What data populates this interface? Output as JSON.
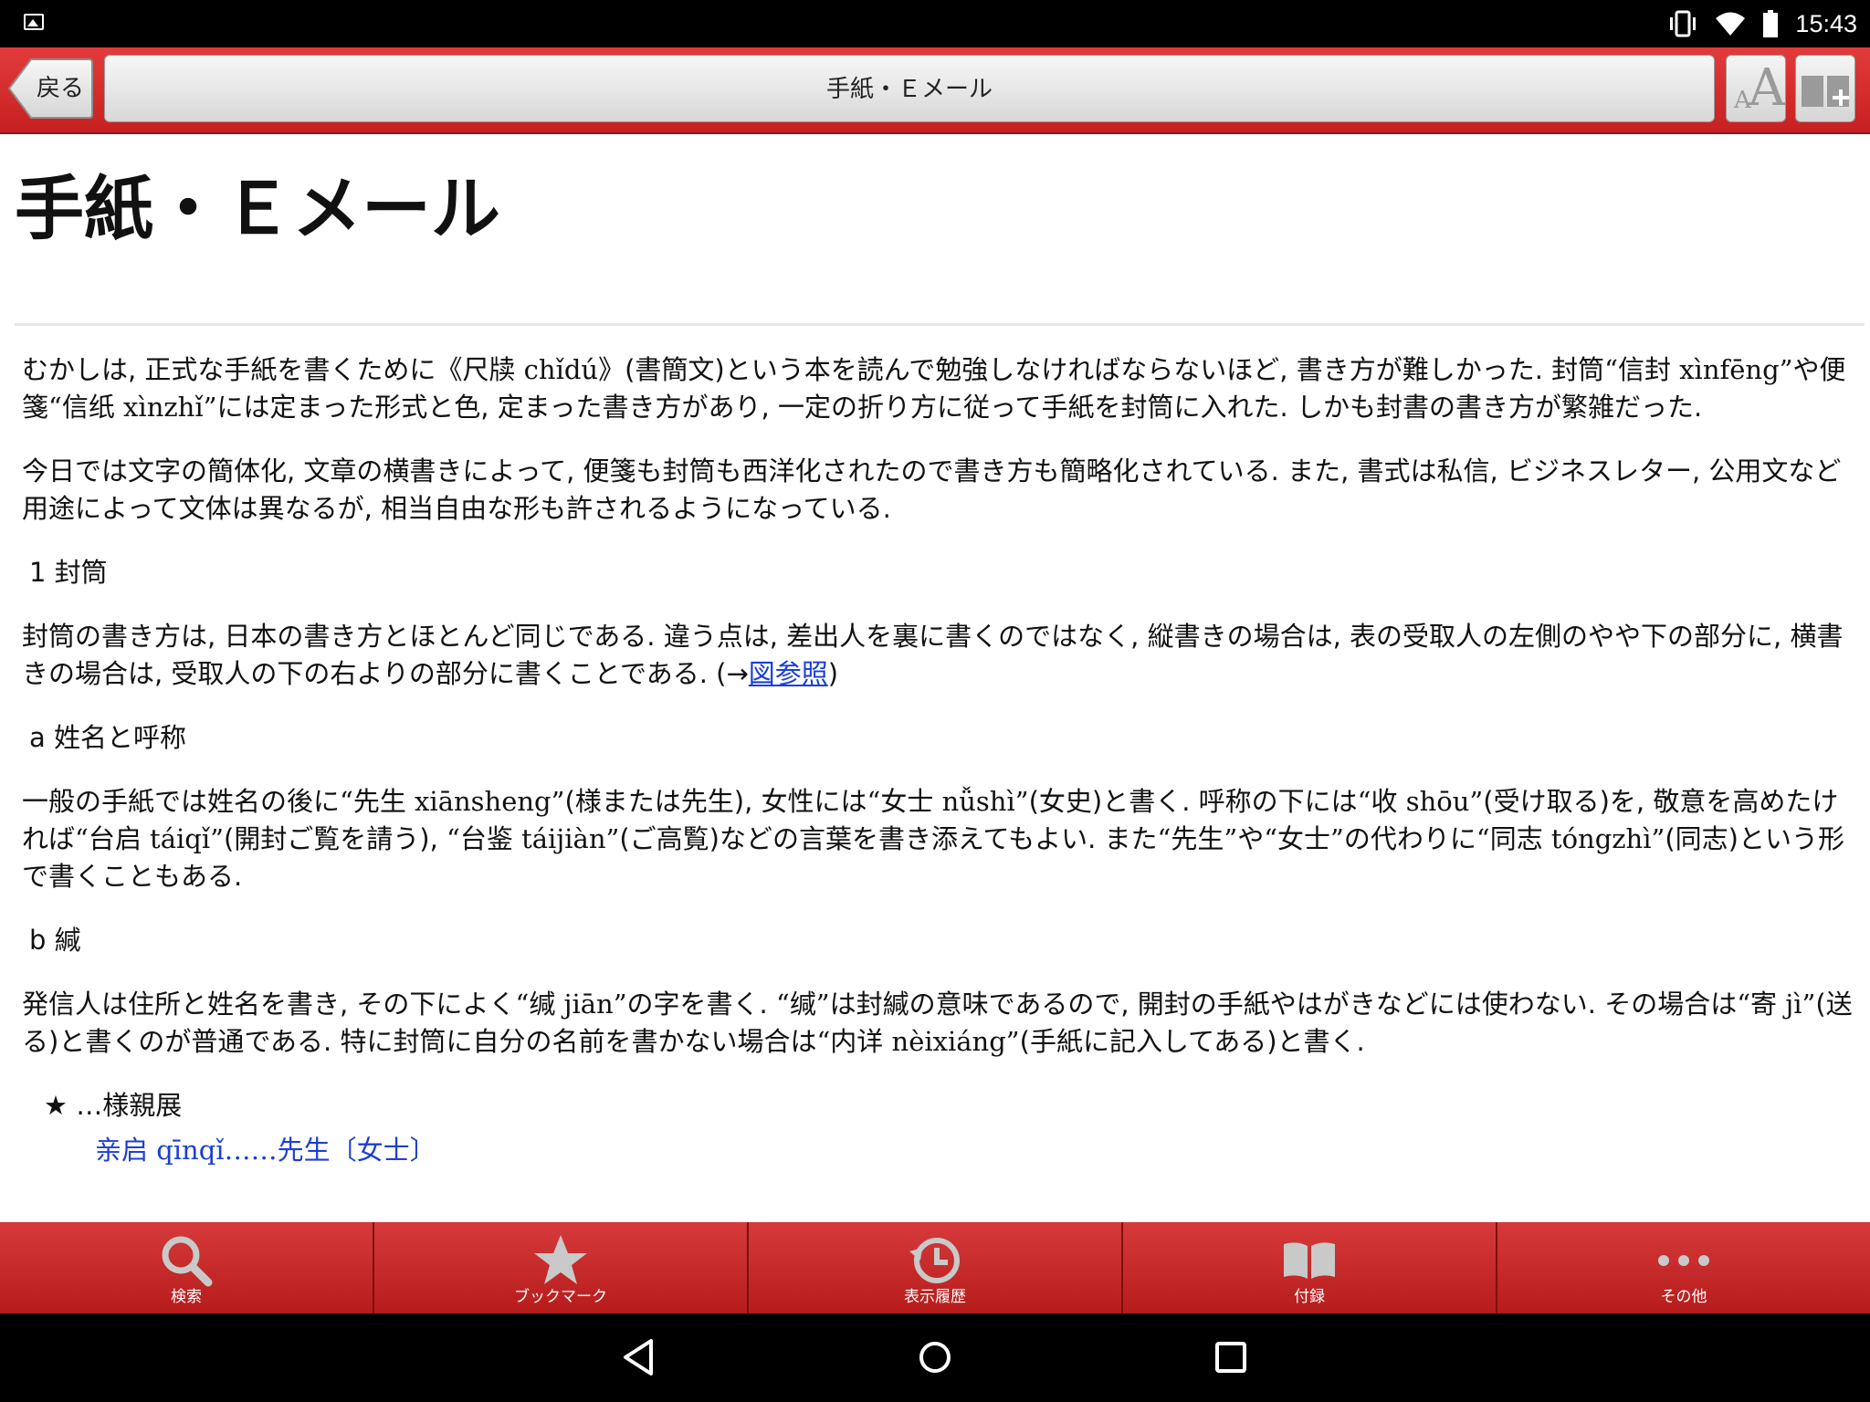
{
  "status_bar": {
    "time": "15:43"
  },
  "toolbar": {
    "back_label": "戻る",
    "title": "手紙・Ｅメール",
    "font_icon_small": "A",
    "font_icon_big": "A"
  },
  "content": {
    "title": "手紙・Ｅメール",
    "p1": [
      "むかしは, 正式な手紙を書くために",
      "《尺牍 chǐdú》",
      "(書簡文)という本を読んで勉強しなければならないほど, 書き方が難しかった. 封筒",
      "“信封 xìnfēng”",
      "や便箋",
      "“信纸 xìnzhǐ”",
      "には定まった形式と色, 定まった書き方があり, 一定の折り方に従って手紙を封筒に入れた. しかも封書の書き方が繁雑だった."
    ],
    "p2": "今日では文字の簡体化, 文章の横書きによって, 便箋も封筒も西洋化されたので書き方も簡略化されている. また, 書式は私信, ビジネスレター, 公用文など用途によって文体は異なるが, 相当自由な形も許されるようになっている.",
    "h1": "1 封筒",
    "p3_before": "封筒の書き方は, 日本の書き方とほとんど同じである. 違う点は, 差出人を裏に書くのではなく, 縦書きの場合は, 表の受取人の左側のやや下の部分に, 横書きの場合は, 受取人の下の右よりの部分に書くことである. (→",
    "p3_link": "図参照",
    "p3_after": ")",
    "h2": "a 姓名と呼称",
    "p4": [
      "一般の手紙では姓名の後に",
      "“先生 xiānsheng”",
      "(様または先生), 女性には",
      "“女士 nǚshì”",
      "(女史)と書く. 呼称の下には",
      "“收 shōu”",
      "(受け取る)を, 敬意を高めたければ",
      "“台启 táiqǐ”",
      "(開封ご覧を請う), ",
      "“台鉴 táijiàn”",
      "(ご高覧)などの言葉を書き添えてもよい. また",
      "“先生”",
      "や",
      "“女士”",
      "の代わりに",
      "“同志 tóngzhì”",
      "(同志)という形で書くこともある."
    ],
    "h3": "b 緘",
    "p5": [
      "発信人は住所と姓名を書き, その下によく",
      "“缄 jiān”",
      "の字を書く. ",
      "“缄”",
      "は封緘の意味であるので, 開封の手紙やはがきなどには使わない. その場合は",
      "“寄 jì”",
      "(送る)と書くのが普通である. 特に封筒に自分の名前を書かない場合は",
      "“内详 nèixiáng”",
      "(手紙に記入してある)と書く."
    ],
    "star_line": "★ …様親展",
    "example": "亲启 qīnqǐ……先生〔女士〕"
  },
  "tabs": [
    {
      "label": "検索",
      "icon": "search-icon"
    },
    {
      "label": "ブックマーク",
      "icon": "star-icon"
    },
    {
      "label": "表示履歴",
      "icon": "history-icon"
    },
    {
      "label": "付録",
      "icon": "book-icon"
    },
    {
      "label": "その他",
      "icon": "more-icon"
    }
  ],
  "colors": {
    "toolbar_red": "#c62828",
    "link_blue": "#1a3fd8"
  }
}
